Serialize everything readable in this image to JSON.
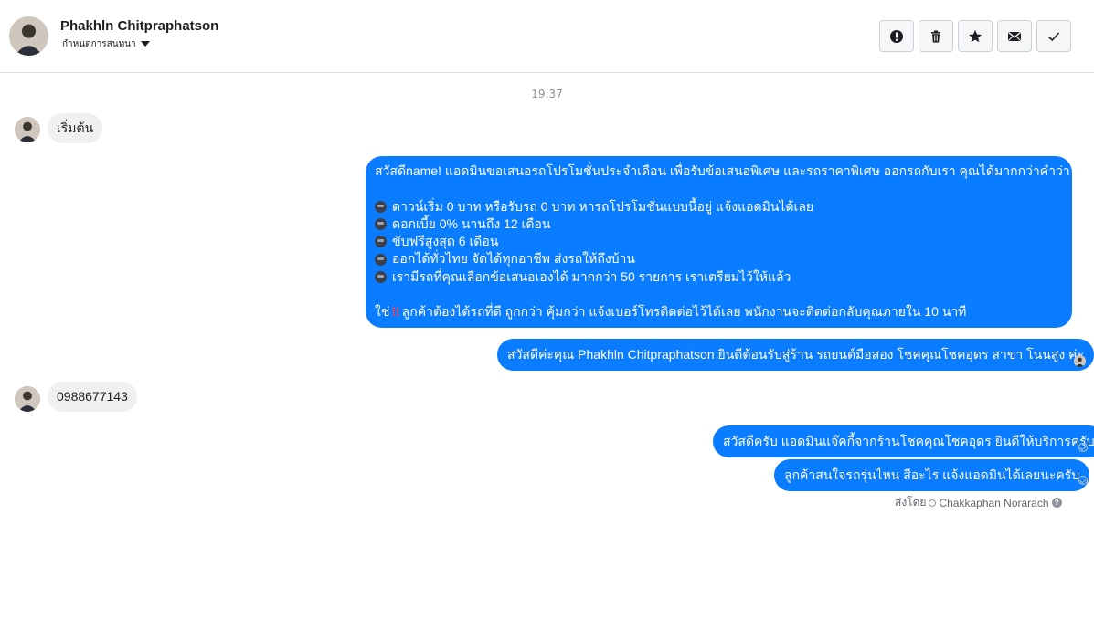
{
  "header": {
    "contact_name": "Phakhln Chitpraphatson",
    "subtitle": "กำหนดการสนทนา",
    "actions": [
      {
        "icon": "alert-icon",
        "label": "!"
      },
      {
        "icon": "trash-icon"
      },
      {
        "icon": "star-icon"
      },
      {
        "icon": "mail-icon"
      },
      {
        "icon": "check-icon"
      }
    ]
  },
  "conversation": {
    "timestamp": "19:37",
    "messages": [
      {
        "direction": "in",
        "text": "เริ่มต้น"
      },
      {
        "direction": "out",
        "lines": [
          "สวัสดีname! แอดมินขอเสนอรถโปรโมชั่นประจำเดือน เพื่อรับข้อเสนอพิเศษ และรถราคาพิเศษ ออกรถกับเรา คุณได้มากกว่าคำว่า \"ถูก\"",
          "",
          "ดาวน์เริ่ม 0 บาท หรือรับรถ 0 บาท หารถโปรโมชั่นแบบนี้อยู่ แจ้งแอดมินได้เลย",
          "ดอกเบี้ย 0% นานถึง 12 เดือน",
          "ขับฟรีสูงสุด 6 เดือน",
          "ออกได้ทั่วไทย จัดได้ทุกอาชีพ ส่งรถให้ถึงบ้าน",
          "เรามีรถที่คุณเลือกข้อเสนอเองได้ มากกว่า 50 รายการ เราเตรียมไว้ให้แล้ว",
          "",
          "ใช่",
          "ลูกค้าต้องได้รถที่ดี ถูกกว่า คุ้มกว่า แจ้งเบอร์โทรติดต่อไว้ได้เลย พนักงานจะติดต่อกลับคุณภายใน 10 นาที"
        ]
      },
      {
        "direction": "out",
        "text": "สวัสดีค่ะคุณ Phakhln Chitpraphatson ยินดีต้อนรับสู่ร้าน รถยนต์มือสอง โชคคุณโชคอุดร สาขา โนนสูง ค่ะ"
      },
      {
        "direction": "in",
        "text": "0988677143"
      },
      {
        "direction": "out",
        "text": "สวัสดีครับ แอดมินแจ๊คกี้จากร้านโชคคุณโชคอุดร ยินดีให้บริการครับ"
      },
      {
        "direction": "out",
        "text": "ลูกค้าสนใจรถรุ่นไหน สีอะไร แจ้งแอดมินได้เลยนะครับ"
      }
    ],
    "sent_by_label": "ส่งโดย",
    "sent_by_name": "Chakkaphan Norarach",
    "help_glyph": "?"
  },
  "colors": {
    "outgoing_bubble": "#0a7cff",
    "incoming_bubble": "#f1f0f0",
    "alert_emoji": "#ff3b4a"
  }
}
